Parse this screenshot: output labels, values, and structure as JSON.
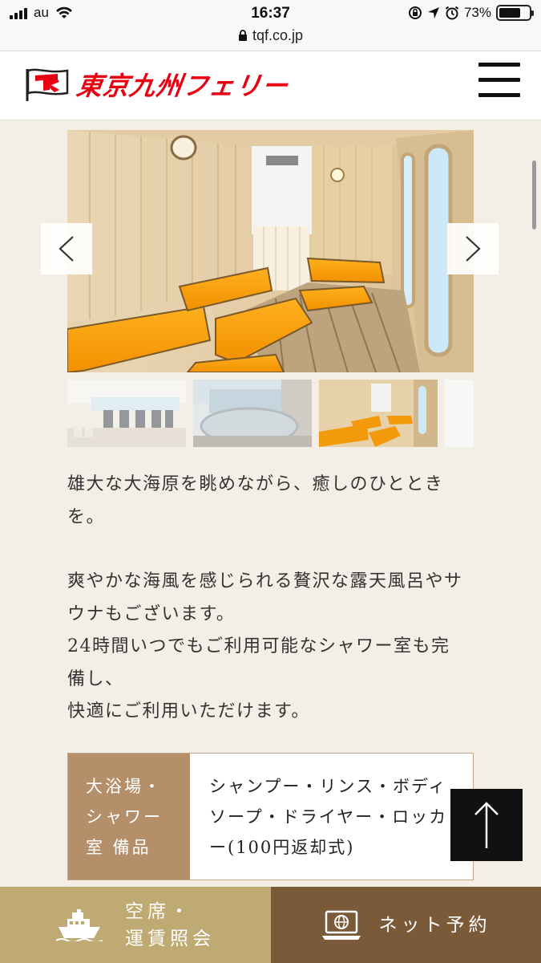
{
  "status_bar": {
    "carrier": "au",
    "time": "16:37",
    "battery": "73%",
    "battery_level": 0.73
  },
  "url_bar": {
    "domain": "tqf.co.jp"
  },
  "header": {
    "logo_text": "東京九州フェリー",
    "menu_icon": "hamburger-icon"
  },
  "slider": {
    "main_image": "sauna-room-photo",
    "thumbnails": [
      {
        "image": "shower-room-photo"
      },
      {
        "image": "open-air-bath-photo"
      },
      {
        "image": "sauna-room-photo"
      }
    ],
    "prev_icon": "chevron-left-icon",
    "next_icon": "chevron-right-icon"
  },
  "description": {
    "paragraph1": "雄大な大海原を眺めながら、癒しのひとときを。",
    "paragraph2_lines": [
      "爽やかな海風を感じられる贅沢な露天風呂やサウナもございます。",
      "24時間いつでもご利用可能なシャワー室も完備し、",
      "快適にご利用いただけます。"
    ]
  },
  "amenities": {
    "label": "大浴場・シャワー室 備品",
    "value": "シャンプー・リンス・ボディソープ・ドライヤー・ロッカー(100円返却式)"
  },
  "back_to_top": {
    "icon": "arrow-up-icon"
  },
  "bottom_bar": {
    "left": {
      "label_line1": "空席・",
      "label_line2": "運賃照会",
      "icon": "ship-icon"
    },
    "right": {
      "label": "ネット予約",
      "icon": "laptop-globe-icon"
    }
  },
  "colors": {
    "background": "#f4efe6",
    "brand_red": "#e60012",
    "table_label_bg": "#b48f6a",
    "bottom_left_bg": "#c0aa73",
    "bottom_right_bg": "#7b5a3a"
  }
}
